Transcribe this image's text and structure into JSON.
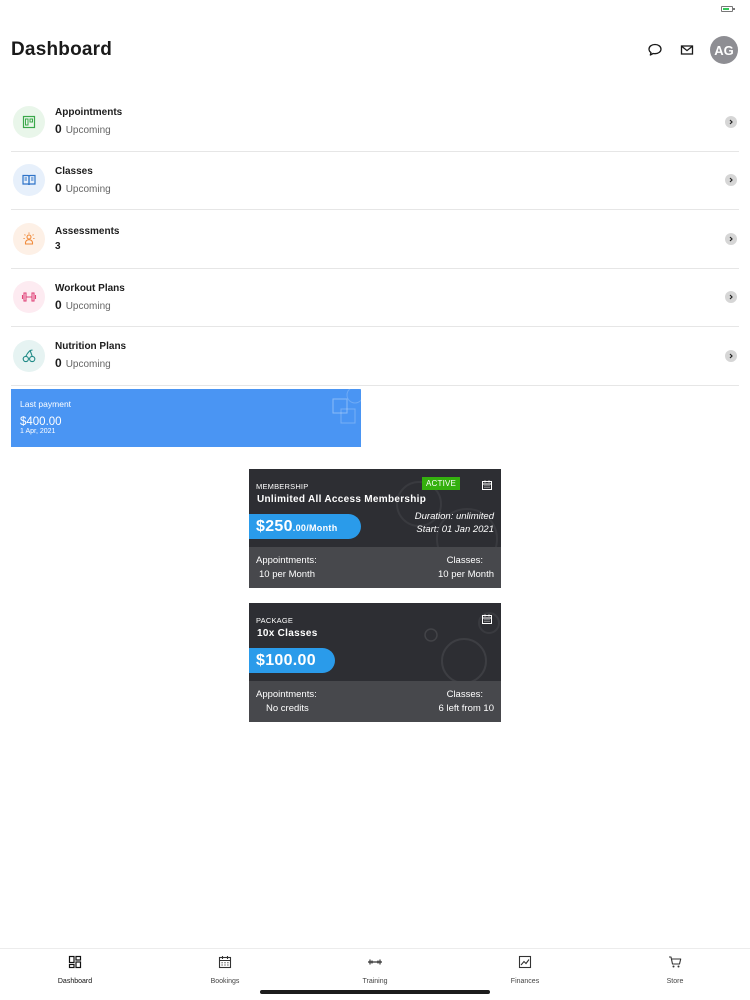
{
  "header": {
    "title": "Dashboard",
    "avatar_initials": "AG"
  },
  "summary": [
    {
      "label": "Appointments",
      "count": "0",
      "suffix": "Upcoming",
      "icon": "appointments-icon",
      "color": "#3aa84a",
      "bg": "#e9f6ea"
    },
    {
      "label": "Classes",
      "count": "0",
      "suffix": "Upcoming",
      "icon": "classes-book-icon",
      "color": "#2f74c9",
      "bg": "#e7f0fb"
    },
    {
      "label": "Assessments",
      "count": "3",
      "suffix": "",
      "icon": "assessments-icon",
      "color": "#f08a3a",
      "bg": "#fdf0e6"
    },
    {
      "label": "Workout Plans",
      "count": "0",
      "suffix": "Upcoming",
      "icon": "dumbbell-icon",
      "color": "#e0467a",
      "bg": "#fdebf1"
    },
    {
      "label": "Nutrition Plans",
      "count": "0",
      "suffix": "Upcoming",
      "icon": "cherries-icon",
      "color": "#1f8a86",
      "bg": "#e6f3f2"
    }
  ],
  "last_payment": {
    "label": "Last payment",
    "amount": "$400.00",
    "date": "1 Apr, 2021"
  },
  "membership": {
    "type": "MEMBERSHIP",
    "name": "Unlimited All Access Membership",
    "status": "ACTIVE",
    "price_main": "$250",
    "price_suffix": ".00/Month",
    "duration": "Duration: unlimited",
    "start": "Start: 01 Jan 2021",
    "appointments_label": "Appointments:",
    "appointments_value": "10 per Month",
    "classes_label": "Classes:",
    "classes_value": "10 per Month"
  },
  "package": {
    "type": "PACKAGE",
    "name": "10x Classes",
    "price_main": "$100.00",
    "appointments_label": "Appointments:",
    "appointments_value": "No credits",
    "classes_label": "Classes:",
    "classes_value": "6 left from 10"
  },
  "tabs": [
    {
      "label": "Dashboard",
      "icon": "dashboard-icon",
      "active": true
    },
    {
      "label": "Bookings",
      "icon": "calendar-icon",
      "active": false
    },
    {
      "label": "Training",
      "icon": "training-icon",
      "active": false
    },
    {
      "label": "Finances",
      "icon": "finances-chart-icon",
      "active": false
    },
    {
      "label": "Store",
      "icon": "cart-icon",
      "active": false
    }
  ],
  "colors": {
    "accent_blue": "#4a95f3",
    "price_blue": "#2a9bea",
    "active_green": "#34b00e",
    "card_dark": "#2d2e33"
  }
}
